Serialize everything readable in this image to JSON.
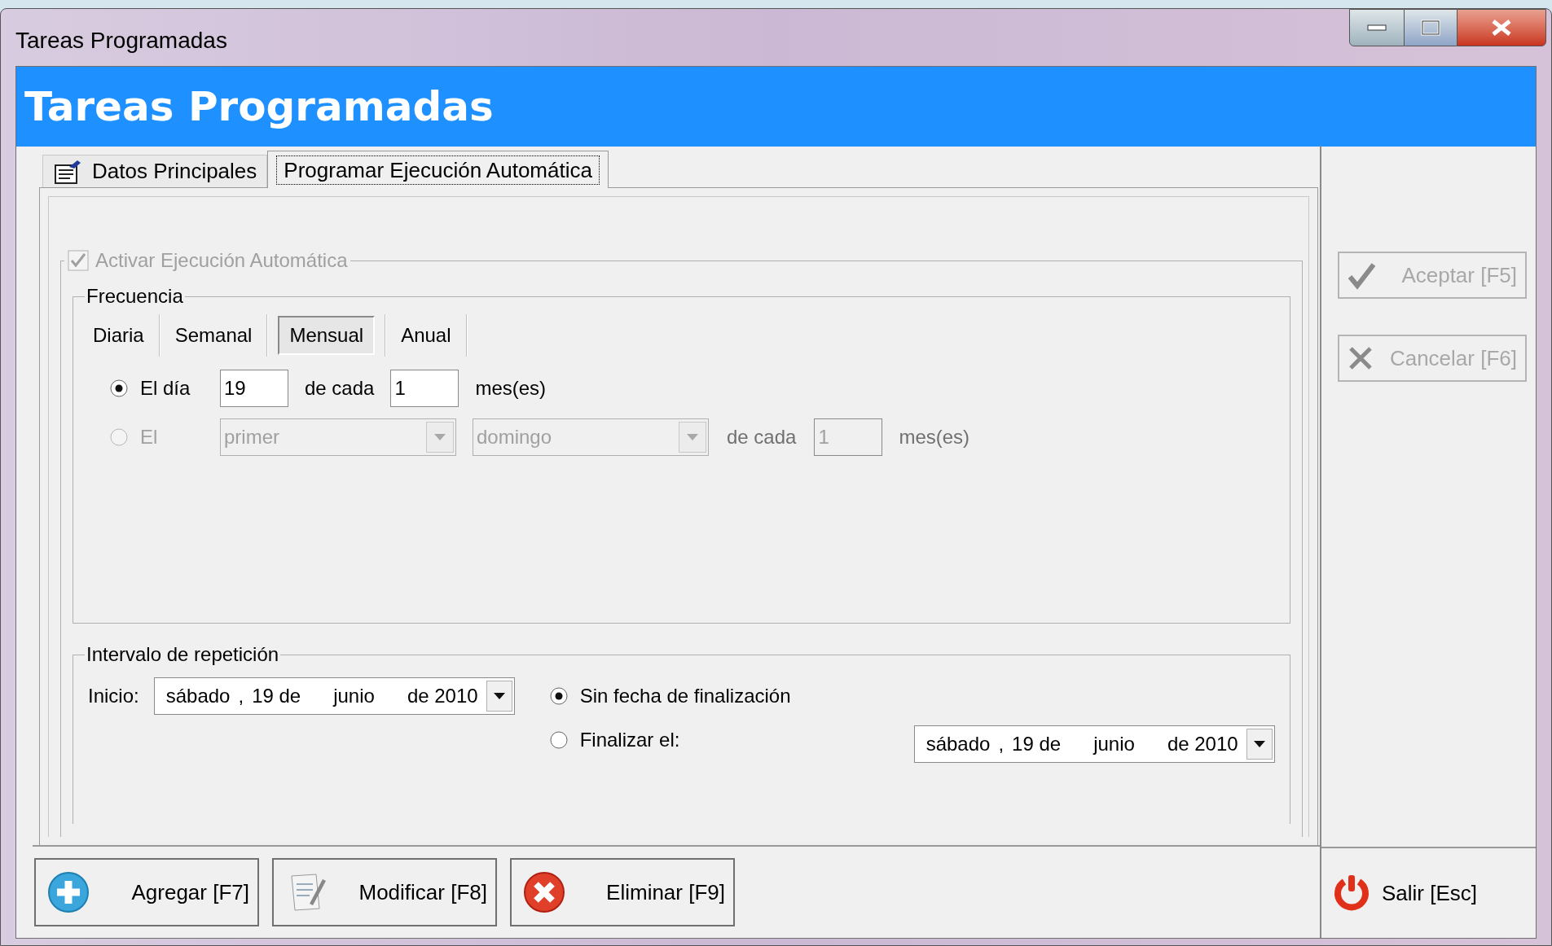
{
  "window": {
    "title": "Tareas Programadas"
  },
  "header": {
    "title": "Tareas Programadas"
  },
  "tabs": [
    {
      "label": "Datos Principales",
      "selected": false,
      "has_icon": true
    },
    {
      "label": "Programar Ejecución Automática",
      "selected": true,
      "has_icon": false
    }
  ],
  "activation": {
    "label": "Activar Ejecución Automática",
    "checked": true,
    "disabled": true
  },
  "frequency": {
    "title": "Frecuencia",
    "options": [
      {
        "label": "Diaria",
        "selected": false
      },
      {
        "label": "Semanal",
        "selected": false
      },
      {
        "label": "Mensual",
        "selected": true
      },
      {
        "label": "Anual",
        "selected": false
      }
    ],
    "rows": [
      {
        "kind": "day",
        "selected": true,
        "disabled": false,
        "label": "El día",
        "day": "19",
        "middle": "de cada",
        "months": "1",
        "suffix": "mes(es)"
      },
      {
        "kind": "weekday",
        "selected": false,
        "disabled": true,
        "label": "El",
        "ordinal": "primer",
        "weekday": "domingo",
        "middle": "de cada",
        "months": "1",
        "suffix": "mes(es)"
      }
    ]
  },
  "interval": {
    "title": "Intervalo de repetición",
    "start_label": "Inicio:",
    "start_date": [
      "sábado",
      ",",
      "19 de",
      "junio",
      "de 2010"
    ],
    "end_options": [
      {
        "label": "Sin fecha de finalización",
        "selected": true
      },
      {
        "label": "Finalizar el:",
        "selected": false
      }
    ],
    "end_date": [
      "sábado",
      ",",
      "19 de",
      "junio",
      "de 2010"
    ]
  },
  "side_buttons": [
    {
      "kind": "check",
      "label": "Aceptar [F5]",
      "disabled": true
    },
    {
      "kind": "cross",
      "label": "Cancelar [F6]",
      "disabled": true
    }
  ],
  "actions": [
    {
      "kind": "add",
      "label": "Agregar [F7]"
    },
    {
      "kind": "edit",
      "label": "Modificar [F8]"
    },
    {
      "kind": "delete",
      "label": "Eliminar [F9]"
    }
  ],
  "exit": {
    "label": "Salir [Esc]"
  }
}
